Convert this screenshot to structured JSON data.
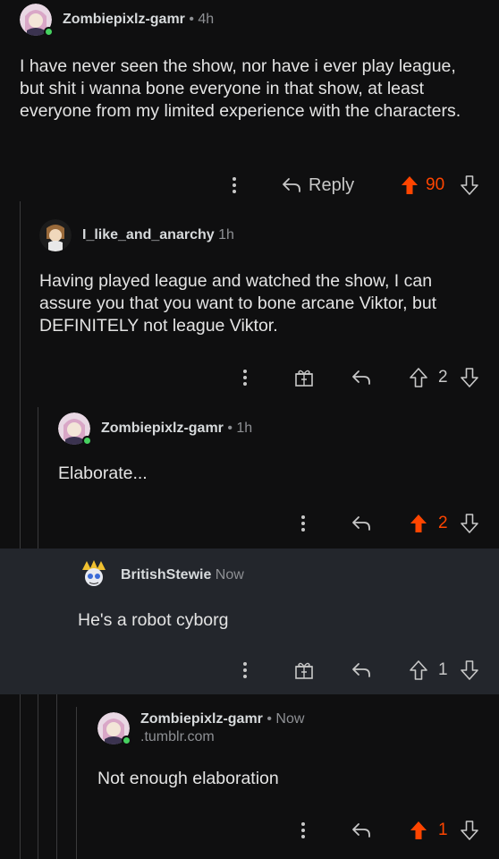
{
  "comments": [
    {
      "username": "Zombiepixlz-gamr",
      "meta": " • 4h",
      "text": "I have never seen the show, nor have i ever play league, but shit i wanna bone everyone in that show, at least everyone from my limited experience with the characters.",
      "reply_label": "Reply",
      "score": "90",
      "upvoted": true
    },
    {
      "username": "I_like_and_anarchy",
      "meta": " 1h",
      "text": "Having played league and watched the show, I can assure you that you want to bone arcane Viktor, but DEFINITELY not league Viktor.",
      "score": "2",
      "upvoted": false
    },
    {
      "username": "Zombiepixlz-gamr",
      "meta": " • 1h",
      "text": "Elaborate...",
      "score": "2",
      "upvoted": true
    },
    {
      "username": "BritishStewie",
      "meta": " Now",
      "text": "He's a robot cyborg",
      "score": "1",
      "upvoted": false
    },
    {
      "username": "Zombiepixlz-gamr",
      "meta": " • Now",
      "sub_meta": ".tumblr.com",
      "text": "Not enough elaboration",
      "score": "1",
      "upvoted": true
    }
  ],
  "colors": {
    "upvote": "#ff4500",
    "online": "#46d160",
    "highlight_bg": "#23262c"
  },
  "icons": [
    "more-vertical-icon",
    "reply-arrow-icon",
    "upvote-arrow-icon",
    "downvote-arrow-icon",
    "award-gift-icon"
  ]
}
